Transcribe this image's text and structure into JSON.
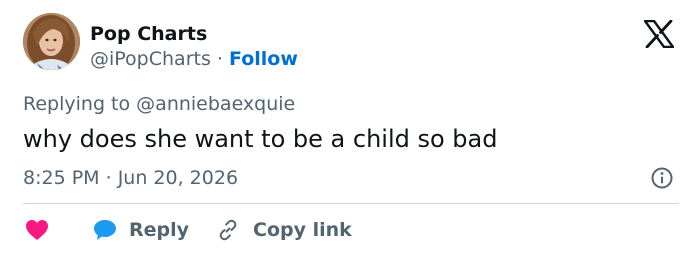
{
  "author": {
    "name": "Pop Charts",
    "handle": "@iPopCharts",
    "separator": "·",
    "follow_label": "Follow",
    "avatar_icon": "profile-photo"
  },
  "reply_context": {
    "prefix": "Replying to",
    "mention": "@anniebaexquie"
  },
  "tweet": {
    "text": "why does she want to be a child so bad",
    "time": "8:25 PM",
    "separator": "·",
    "date": "Jun 20, 2026"
  },
  "actions": {
    "like_icon": "heart-icon",
    "reply_label": "Reply",
    "copy_link_label": "Copy link"
  },
  "colors": {
    "follow_blue": "#006fd6",
    "heart_red": "#f91880",
    "reply_blue": "#1d9bf0",
    "muted_text": "#536471",
    "primary_text": "#0f1419",
    "divider": "#cfd9de"
  },
  "icons": {
    "brand": "x-logo-icon",
    "info": "info-icon",
    "reply": "speech-bubble-icon",
    "copy": "link-icon"
  }
}
